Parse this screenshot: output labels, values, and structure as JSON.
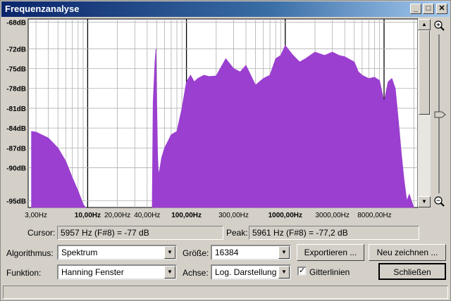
{
  "window": {
    "title": "Frequenzanalyse"
  },
  "titlebar_buttons": {
    "minimize": "_",
    "maximize": "□",
    "close": "✕"
  },
  "chart_data": {
    "type": "area",
    "title": "",
    "xlabel": "",
    "ylabel": "",
    "x_scale": "log",
    "xlim": [
      2.5,
      22000
    ],
    "ylim": [
      -96,
      -67.5
    ],
    "grid": true,
    "color": "#9a3fcf",
    "y_ticks": [
      "-68dB",
      "-72dB",
      "-75dB",
      "-78dB",
      "-81dB",
      "-84dB",
      "-87dB",
      "-90dB",
      "-95dB"
    ],
    "x_ticks": [
      {
        "label": "3,00Hz",
        "value": 3,
        "bold": false
      },
      {
        "label": "10,00Hz",
        "value": 10,
        "bold": true
      },
      {
        "label": "20,00Hz",
        "value": 20,
        "bold": false
      },
      {
        "label": "40,00Hz",
        "value": 40,
        "bold": false
      },
      {
        "label": "100,00Hz",
        "value": 100,
        "bold": true
      },
      {
        "label": "300,00Hz",
        "value": 300,
        "bold": false
      },
      {
        "label": "1000,00Hz",
        "value": 1000,
        "bold": true
      },
      {
        "label": "3000,00Hz",
        "value": 3000,
        "bold": false
      },
      {
        "label": "8000,00Hz",
        "value": 8000,
        "bold": false
      }
    ],
    "series": [
      {
        "x": [
          2.7,
          3,
          4,
          5,
          6,
          7,
          8,
          9,
          9.5
        ],
        "y": [
          -84.5,
          -84.6,
          -85.5,
          -87,
          -89,
          -91.5,
          -93.5,
          -95.5,
          -96
        ]
      },
      {
        "x": [
          45,
          46,
          48,
          49,
          50,
          51,
          52,
          54,
          56,
          60,
          65,
          70,
          80,
          90,
          100,
          110,
          120,
          130,
          150,
          170,
          200,
          250,
          300,
          350,
          400,
          500,
          600,
          700,
          800,
          900,
          1000,
          1200,
          1400,
          1600,
          2000,
          2500,
          3000,
          3500,
          4000,
          5000,
          5500,
          6000,
          7000,
          8000,
          9000,
          10000,
          11000,
          12000,
          13000,
          14000,
          15000,
          16000,
          17000,
          18000,
          20000
        ],
        "y": [
          -96,
          -80,
          -74,
          -72,
          -80,
          -88,
          -91,
          -90,
          -88.5,
          -87,
          -86,
          -85,
          -84.5,
          -81,
          -77,
          -76,
          -77,
          -76.5,
          -76,
          -76.2,
          -76.1,
          -73.5,
          -75,
          -75.5,
          -74.5,
          -77.5,
          -76.5,
          -76,
          -73.5,
          -73,
          -71.5,
          -73,
          -74,
          -73.5,
          -72.5,
          -73,
          -72.5,
          -73,
          -73.2,
          -74,
          -75.5,
          -76,
          -76.5,
          -76.3,
          -76.8,
          -80,
          -77,
          -76.5,
          -78,
          -83,
          -88,
          -92,
          -95,
          -94,
          -96
        ]
      }
    ]
  },
  "cursor": {
    "label": "Cursor:",
    "value": "5957 Hz (F#8) = -77 dB"
  },
  "peak": {
    "label": "Peak:",
    "value": "5961 Hz (F#8) = -77,2 dB"
  },
  "controls": {
    "algorithm_label": "Algorithmus:",
    "algorithm_value": "Spektrum",
    "size_label": "Größe:",
    "size_value": "16384",
    "function_label": "Funktion:",
    "function_value": "Hanning Fenster",
    "axis_label": "Achse:",
    "axis_value": "Log. Darstellung",
    "grid_label": "Gitterlinien",
    "grid_checked": true
  },
  "buttons": {
    "export": "Exportieren ...",
    "redraw": "Neu zeichnen ...",
    "close": "Schließen"
  }
}
